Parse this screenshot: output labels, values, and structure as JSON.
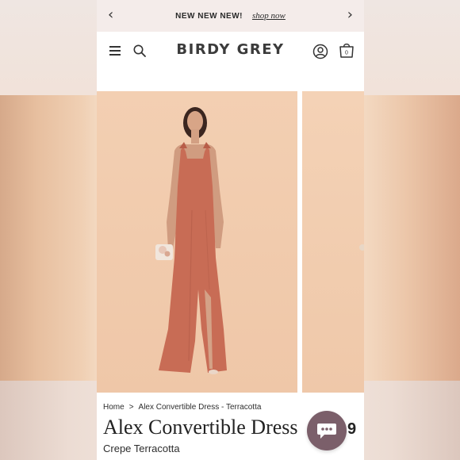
{
  "promo": {
    "text": "NEW NEW NEW!",
    "link": "shop now"
  },
  "header": {
    "logo": "BIRDY GREY",
    "bag_count": "0"
  },
  "product": {
    "breadcrumb": {
      "home": "Home",
      "separator": ">",
      "current": "Alex Convertible Dress - Terracotta"
    },
    "title": "Alex Convertible Dress",
    "variant": "Crepe Terracotta",
    "price_fragment": "9"
  },
  "colors": {
    "dress": "#c86c55",
    "chat_button": "#7b5f6a",
    "photo_bg": "#f3cfb2"
  }
}
